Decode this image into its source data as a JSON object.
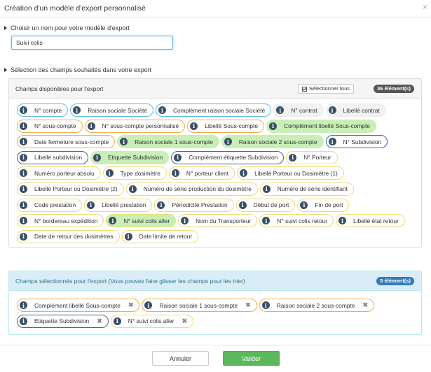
{
  "modal": {
    "title": "Création d'un modèle d'export personnalisé",
    "close": "×"
  },
  "name_section": {
    "label": "Choisir un nom pour votre modèle d'export",
    "value": "Suivi colis"
  },
  "fields_section": {
    "label": "Sélection des champs souhaités dans votre export"
  },
  "available": {
    "title": "Champs disponibles pour l'export",
    "select_all": "Sélectionner tous",
    "count": "36 élément(s)",
    "items": [
      {
        "label": "N° compte",
        "style": "cyan"
      },
      {
        "label": "Raison sociale Société",
        "style": "cyan"
      },
      {
        "label": "Complément raison sociale Société",
        "style": "cyan"
      },
      {
        "label": "N° contrat",
        "style": "gray"
      },
      {
        "label": "Libellé contrat",
        "style": "gray"
      },
      {
        "label": "N° sous-compte",
        "style": "orange"
      },
      {
        "label": "N° sous-compte personnalisé",
        "style": "orange"
      },
      {
        "label": "Libellé Sous-compte",
        "style": "orange"
      },
      {
        "label": "Complément libellé Sous-compte",
        "style": "green orange"
      },
      {
        "label": "Date fermeture sous-compte",
        "style": "orange"
      },
      {
        "label": "Raison sociale 1 sous-compte",
        "style": "green orange"
      },
      {
        "label": "Raison sociale 2 sous-compte",
        "style": "green orange"
      },
      {
        "label": "N° Subdivision",
        "style": "navy"
      },
      {
        "label": "Libellé subdivision",
        "style": "navy"
      },
      {
        "label": "Etiquette Subdivision",
        "style": "green navy"
      },
      {
        "label": "Complément étiquette Subdivision",
        "style": "navy"
      },
      {
        "label": "N° Porteur",
        "style": "yellow"
      },
      {
        "label": "Numéro porteur absolu",
        "style": "yellow"
      },
      {
        "label": "Type dosimètre",
        "style": "yellow"
      },
      {
        "label": "N° porteur client",
        "style": "yellow"
      },
      {
        "label": "Libellé Porteur ou Dosimètre (1)",
        "style": "yellow"
      },
      {
        "label": "Libellé Porteur ou Dosimètre (2)",
        "style": "yellow"
      },
      {
        "label": "Numéro de série production du dosimètre",
        "style": "yellow"
      },
      {
        "label": "Numéro de série identifiant",
        "style": "yellow"
      },
      {
        "label": "Code prestation",
        "style": "yellow"
      },
      {
        "label": "Libellé prestation",
        "style": "yellow"
      },
      {
        "label": "Périodicité Prestation",
        "style": "yellow"
      },
      {
        "label": "Début de port",
        "style": "yellow"
      },
      {
        "label": "Fin de port",
        "style": "yellow"
      },
      {
        "label": "N° bordereau expédition",
        "style": "yellow"
      },
      {
        "label": "N° suivi colis aller",
        "style": "green yellow"
      },
      {
        "label": "Nom du Transporteur",
        "style": "yellow"
      },
      {
        "label": "N° suivi colis retour",
        "style": "yellow"
      },
      {
        "label": "Libellé état retour",
        "style": "yellow"
      },
      {
        "label": "Date de retour des dosimètres",
        "style": "yellow"
      },
      {
        "label": "Date limite de retour",
        "style": "yellow"
      }
    ]
  },
  "selected": {
    "title": "Champs sélectionnés pour l'export (Vous pouvez faire glisser les champs pour les trier)",
    "count": "5 élément(s)",
    "remove_glyph": "✖",
    "items": [
      {
        "label": "Complément libellé Sous-compte",
        "style": "orange"
      },
      {
        "label": "Raison sociale 1 sous-compte",
        "style": "orange"
      },
      {
        "label": "Raison sociale 2 sous-compte",
        "style": "orange"
      },
      {
        "label": "Etiquette Subdivision",
        "style": "navy"
      },
      {
        "label": "N° suivi colis aller",
        "style": "yellow"
      }
    ]
  },
  "footer": {
    "cancel": "Annuler",
    "ok": "Valider"
  },
  "icon_glyph": "i",
  "colors": {
    "cyan": "#5bc0de",
    "orange": "#f0ad4e",
    "yellow": "#f0dc6e",
    "navy": "#3b6699",
    "green_fill": "#c8efb6",
    "ok_button": "#5cb85c",
    "badge_blue": "#337ab7"
  }
}
